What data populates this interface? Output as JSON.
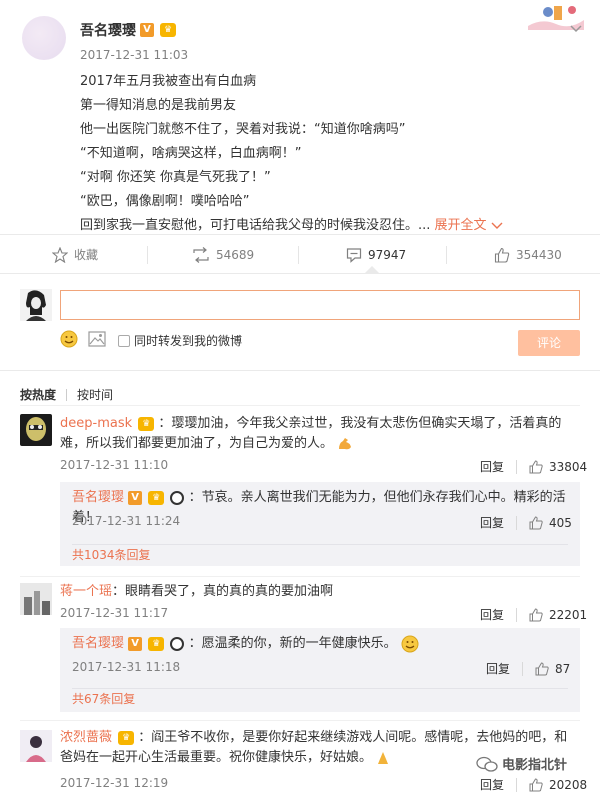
{
  "post": {
    "author": "吾名璎璎",
    "time": "2017-12-31 11:03",
    "lines": [
      "2017年五月我被查出有白血病",
      "第一得知消息的是我前男友",
      "他一出医院门就憋不住了，哭着对我说：“知道你啥病吗”",
      "“不知道啊，啥病哭这样，白血病啊！”",
      "“对啊 你还笑 你真是气死我了！”",
      "“欧巴，偶像剧啊！噗哈哈哈”",
      "回到家我一直安慰他，可打电话给我父母的时候我没忍住。..."
    ],
    "expand": "展开全文"
  },
  "actions": {
    "favorite": "收藏",
    "repost": "54689",
    "comment": "97947",
    "like": "354430"
  },
  "composer": {
    "also_repost": "同时转发到我的微博",
    "submit": "评论"
  },
  "sort": {
    "hot": "按热度",
    "time": "按时间"
  },
  "comments": [
    {
      "user": "deep-mask",
      "text": "：璎璎加油，今年我父亲过世，我没有太悲伤但确实天塌了，活着真的难，所以我们都要更加油了，为自己为爱的人。",
      "time": "2017-12-31 11:10",
      "reply_label": "回复",
      "likes": "33804",
      "reply": {
        "user": "吾名璎璎",
        "text": "：节哀。亲人离世我们无能为力，但他们永存我们心中。精彩的活着！",
        "time": "2017-12-31 11:24",
        "reply_label": "回复",
        "likes": "405"
      },
      "more": "共1034条回复"
    },
    {
      "user": "蒋一个瑶",
      "text": "：眼睛看哭了，真的真的真的要加油啊",
      "time": "2017-12-31 11:17",
      "reply_label": "回复",
      "likes": "22201",
      "reply": {
        "user": "吾名璎璎",
        "text": "：愿温柔的你，新的一年健康快乐。",
        "time": "2017-12-31 11:18",
        "reply_label": "回复",
        "likes": "87"
      },
      "more": "共67条回复"
    },
    {
      "user": "浓烈蔷薇",
      "text": "：阎王爷不收你，是要你好起来继续游戏人间呢。感情呢，去他妈的吧，和爸妈在一起开心生活最重要。祝你健康快乐，好姑娘。",
      "time": "2017-12-31 12:19",
      "reply_label": "回复",
      "likes": "20208"
    }
  ],
  "watermark": "电影指北针",
  "colors": {
    "accent": "#eb7350",
    "submit_bg": "#ffc09f",
    "reply_bg": "#f2f2f5"
  }
}
